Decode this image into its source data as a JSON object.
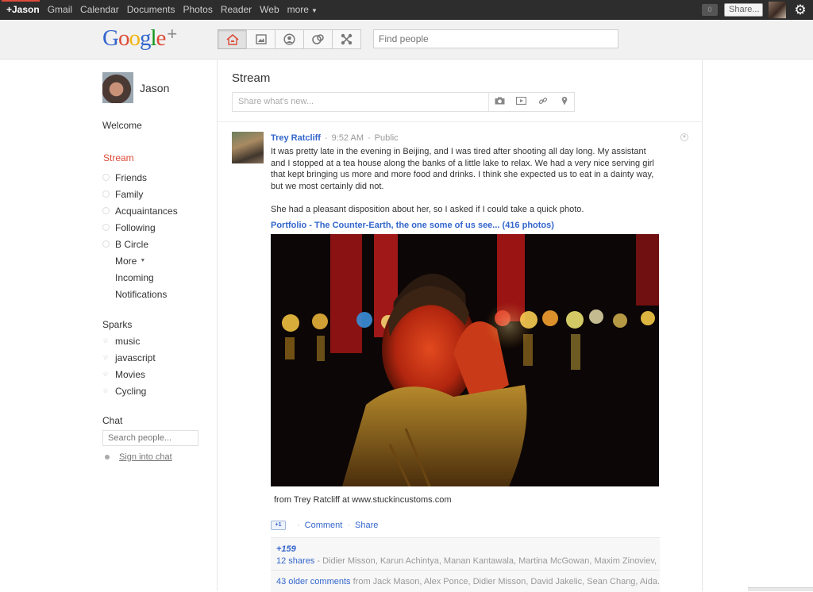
{
  "topbar": {
    "nav": [
      "+Jason",
      "Gmail",
      "Calendar",
      "Documents",
      "Photos",
      "Reader",
      "Web",
      "more"
    ],
    "notifications_count": "0",
    "share_label": "Share...",
    "accent_color": "#dd4b39"
  },
  "header": {
    "logo_letters": [
      "G",
      "o",
      "o",
      "g",
      "l",
      "e"
    ],
    "logo_plus": "+",
    "nav_icons": [
      "home-icon",
      "photos-icon",
      "profile-icon",
      "circles-icon",
      "games-icon"
    ],
    "find_people_placeholder": "Find people"
  },
  "sidebar": {
    "profile_name": "Jason",
    "welcome": "Welcome",
    "stream": "Stream",
    "circles": [
      {
        "label": "Friends"
      },
      {
        "label": "Family"
      },
      {
        "label": "Acquaintances"
      },
      {
        "label": "Following"
      },
      {
        "label": "B Circle"
      }
    ],
    "more": "More",
    "incoming": "Incoming",
    "notifications": "Notifications",
    "sparks_title": "Sparks",
    "sparks": [
      "music",
      "javascript",
      "Movies",
      "Cycling"
    ],
    "chat_title": "Chat",
    "chat_search_placeholder": "Search people...",
    "sign_in_chat": "Sign into chat"
  },
  "stream": {
    "title": "Stream",
    "share_placeholder": "Share what's new...",
    "share_tools": [
      "camera-icon",
      "video-icon",
      "link-icon",
      "location-icon"
    ]
  },
  "post": {
    "author": "Trey Ratcliff",
    "time": "9:52 AM",
    "visibility": "Public",
    "body": "It was pretty late in the evening in Beijing, and I was tired after shooting all day long. My assistant and I stopped at a tea house along the banks of a little lake to relax. We had a very nice serving girl that kept bringing us more and more food and drinks. I think she expected us to eat in a dainty way, but we most certainly did not.",
    "body2": "She had a pleasant disposition about her, so I asked if I could take a quick photo.",
    "album_link": "Portfolio - The Counter-Earth, the one some of us see... (416 photos)",
    "caption": "from Trey Ratcliff at www.stuckincustoms.com",
    "plusone_label": "+1",
    "comment_label": "Comment",
    "share_label": "Share",
    "plus_count": "+159",
    "shares_link": "12 shares",
    "shares_names": " - Didier Misson, Karun Achintya, Manan Kantawala, Martina McGowan, Maxim Zinoviev, ...",
    "older_comments_link": "43 older comments",
    "older_comments_names": " from Jack Mason, Alex Ponce, Didier Misson, David Jakelic, Sean Chang, Aida..."
  }
}
